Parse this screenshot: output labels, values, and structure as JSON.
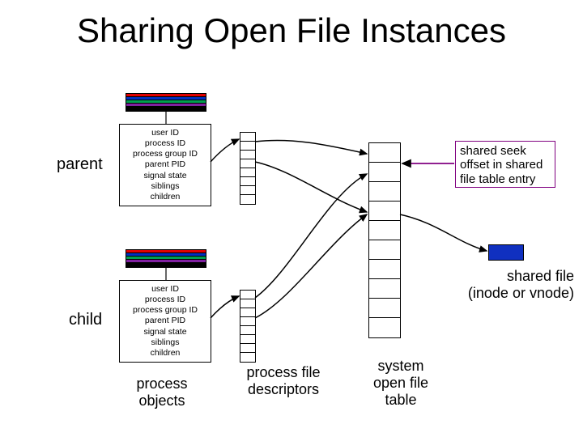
{
  "title": "Sharing Open File Instances",
  "labels": {
    "parent": "parent",
    "child": "child"
  },
  "process_box": {
    "l1": "user ID",
    "l2": "process ID",
    "l3": "process group ID",
    "l4": "parent PID",
    "l5": "signal state",
    "l6": "siblings",
    "l7": "children"
  },
  "captions": {
    "process_objects": "process\nobjects",
    "pfd": "process file\ndescriptors",
    "soft": "system\nopen file\ntable"
  },
  "notes": {
    "seek": "shared seek\noffset in shared\nfile table entry",
    "shared_file": "shared file\n(inode or vnode)"
  }
}
